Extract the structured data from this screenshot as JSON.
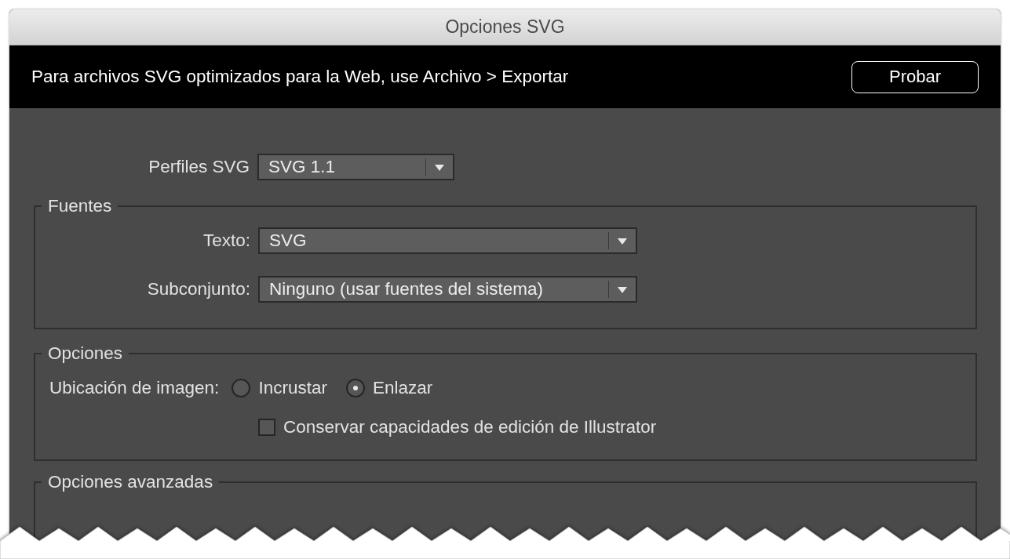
{
  "window": {
    "title": "Opciones SVG"
  },
  "banner": {
    "message": "Para archivos SVG optimizados para la Web, use Archivo > Exportar",
    "button": "Probar"
  },
  "svg_profile": {
    "label": "Perfiles SVG",
    "value": "SVG 1.1"
  },
  "fonts": {
    "title": "Fuentes",
    "fields": [
      {
        "label": "Texto:",
        "value": "SVG"
      },
      {
        "label": "Subconjunto:",
        "value": "Ninguno (usar fuentes del sistema)"
      }
    ]
  },
  "options": {
    "title": "Opciones",
    "image_location": {
      "label": "Ubicación de imagen:",
      "choices": [
        {
          "label": "Incrustar",
          "selected": false
        },
        {
          "label": "Enlazar",
          "selected": true
        }
      ]
    },
    "preserve_editing": {
      "label": "Conservar capacidades de edición de Illustrator",
      "checked": false
    }
  },
  "advanced": {
    "title": "Opciones avanzadas"
  }
}
